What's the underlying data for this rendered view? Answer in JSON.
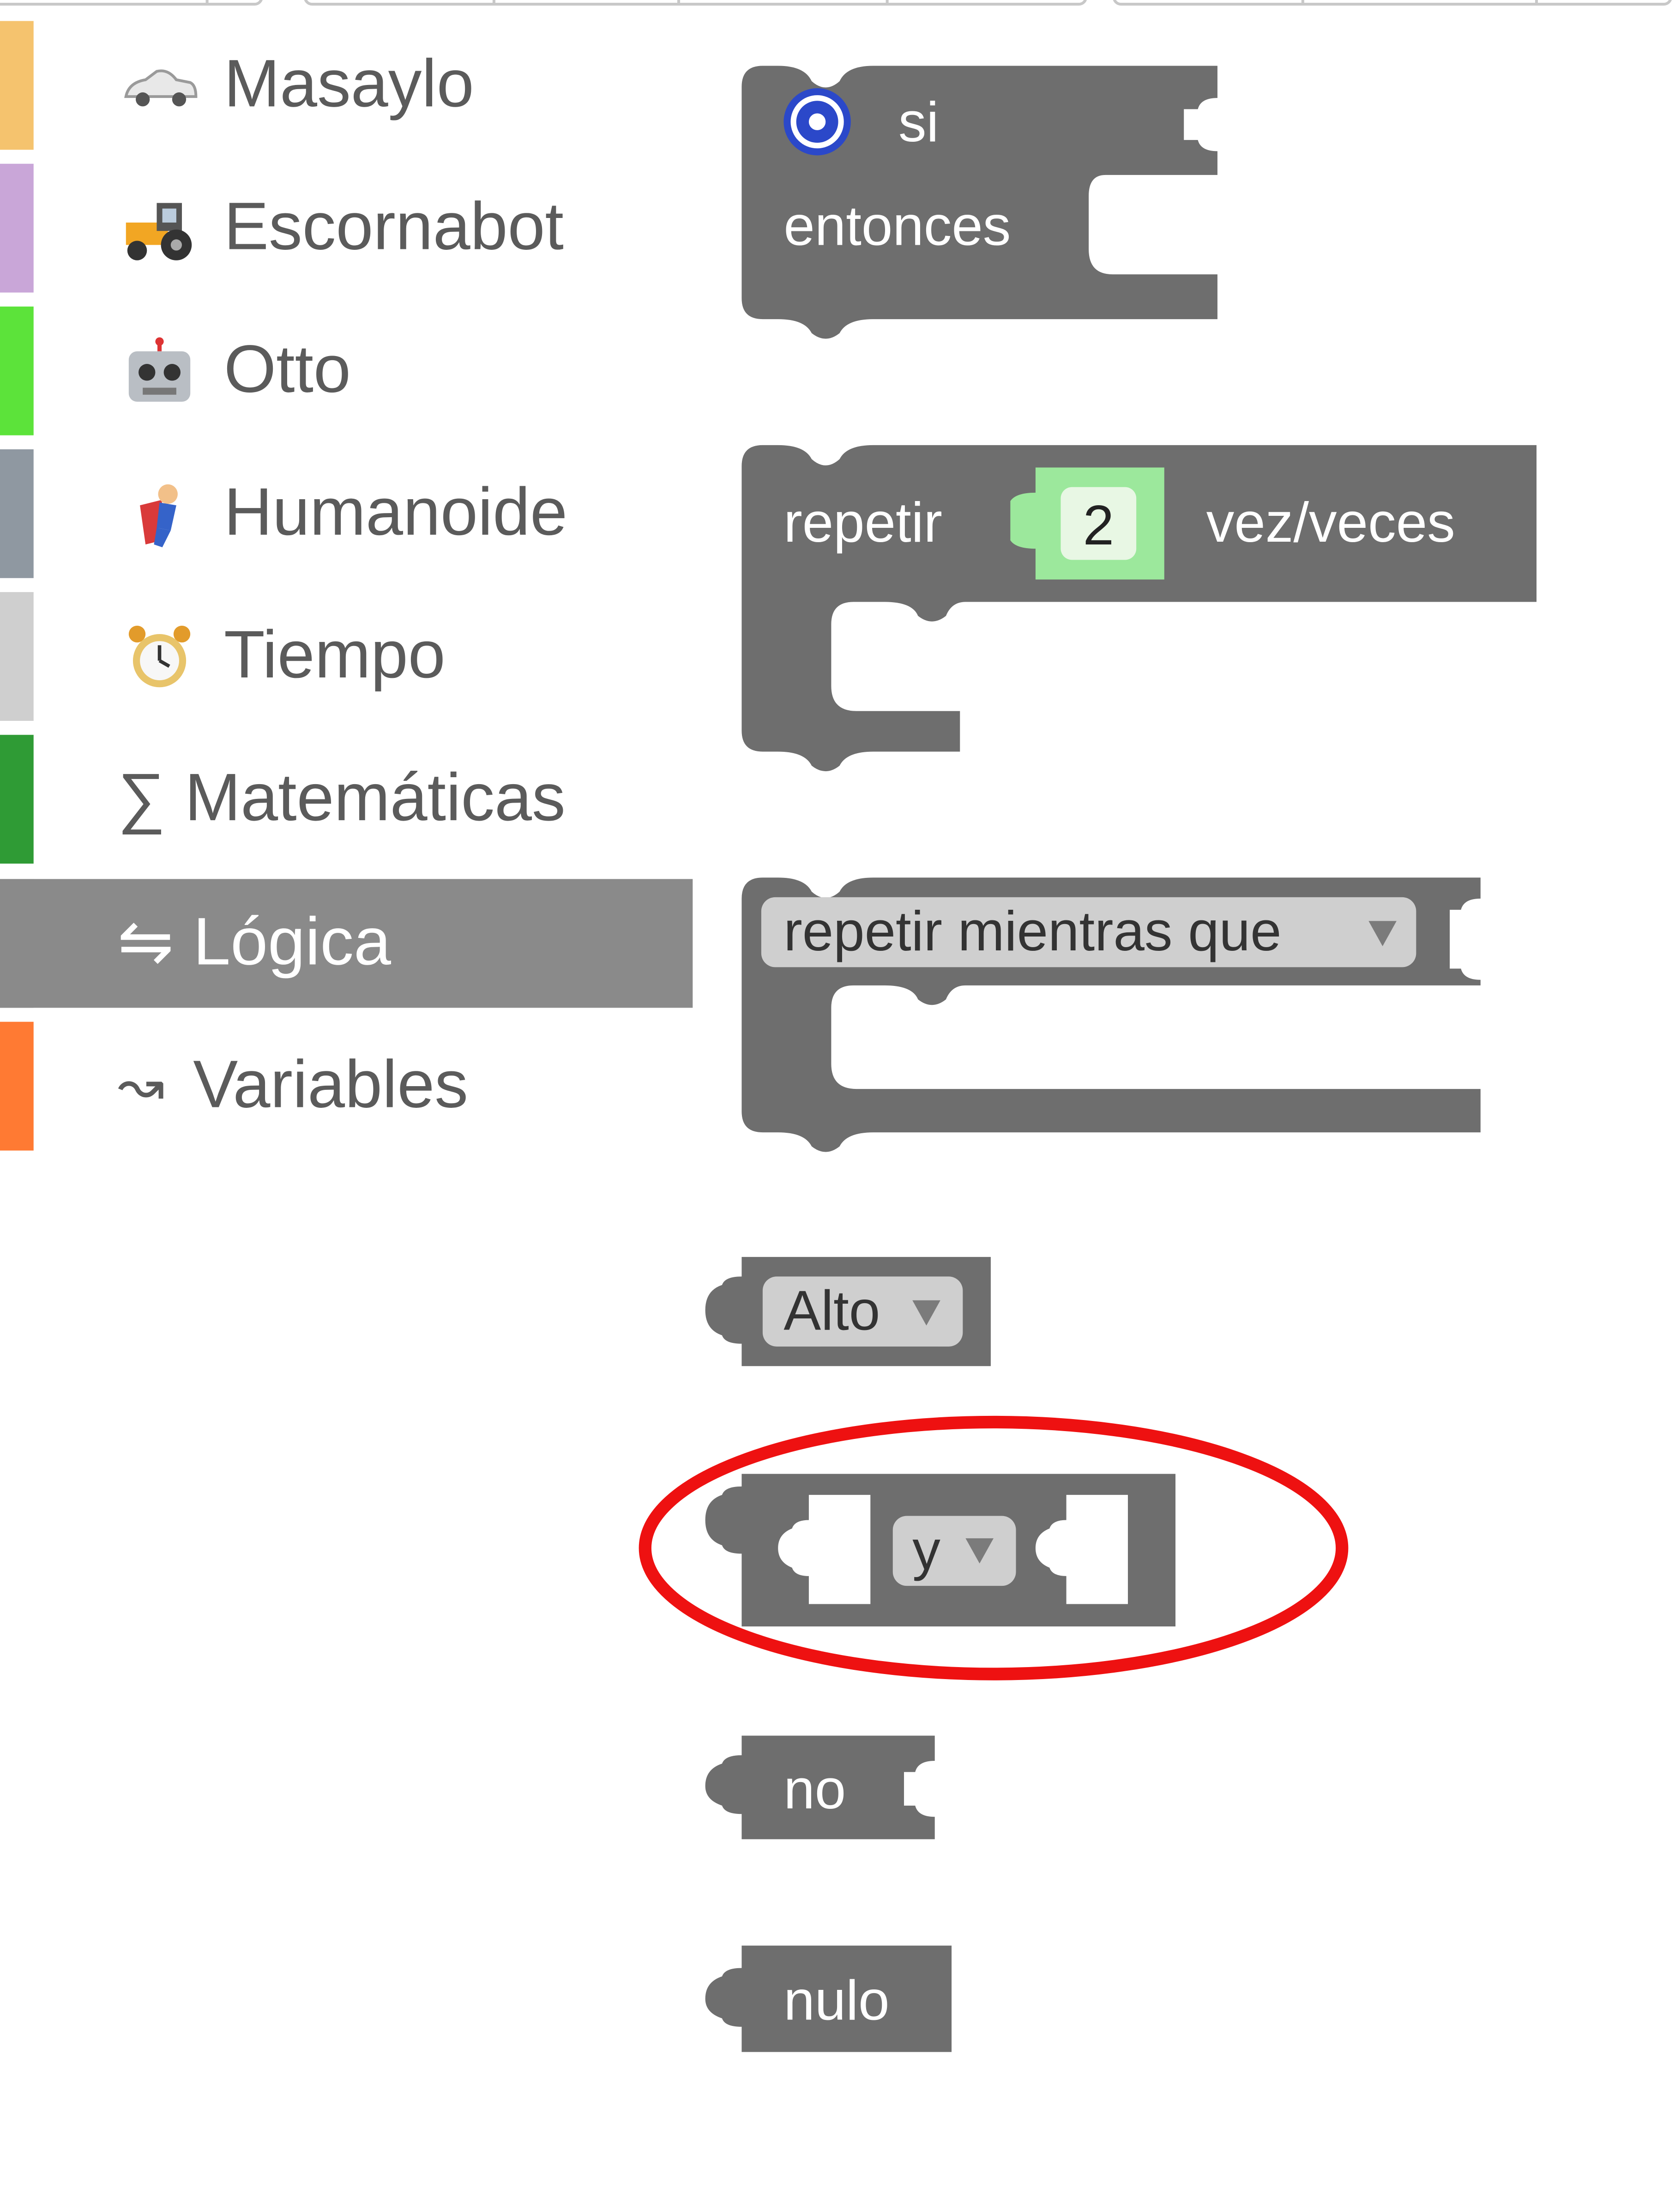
{
  "sidebar": {
    "categories": [
      {
        "label": "Masaylo",
        "icon": "car-icon",
        "color": "#f5c36e",
        "selected": false
      },
      {
        "label": "Escornabot",
        "icon": "tractor-icon",
        "color": "#c9a6d8",
        "selected": false
      },
      {
        "label": "Otto",
        "icon": "robot-icon",
        "color": "#5ce33a",
        "selected": false
      },
      {
        "label": "Humanoide",
        "icon": "superhero-icon",
        "color": "#8f98a1",
        "selected": false
      },
      {
        "label": "Tiempo",
        "icon": "alarm-clock-icon",
        "color": "#cfcfcf",
        "selected": false
      },
      {
        "label": "Matemáticas",
        "icon": "sigma-icon",
        "glyph": "∑",
        "color": "#2f9b35",
        "selected": false
      },
      {
        "label": "Lógica",
        "icon": "logic-arrows-icon",
        "glyph": "⇋",
        "color": "#8a8a8a",
        "selected": true
      },
      {
        "label": "Variables",
        "icon": "squiggle-arrow-icon",
        "glyph": "↝",
        "color": "#ff7a33",
        "selected": false
      }
    ]
  },
  "blocks": {
    "if_block": {
      "label_if": "si",
      "label_then": "entonces",
      "gear_icon": "gear-icon"
    },
    "repeat_block": {
      "label": "repetir",
      "count": "2",
      "suffix": "vez/veces"
    },
    "while_block": {
      "label": "repetir mientras que"
    },
    "boolean_block": {
      "value": "Alto"
    },
    "and_block": {
      "operator": "y",
      "highlight_color": "#ee1111"
    },
    "not_block": {
      "label": "no"
    },
    "null_block": {
      "label": "nulo"
    }
  },
  "colors": {
    "block": "#6e6e6e",
    "dropdown": "#cfcfcf",
    "number_field": "#9ce89c",
    "selected_category": "#8a8a8a"
  }
}
